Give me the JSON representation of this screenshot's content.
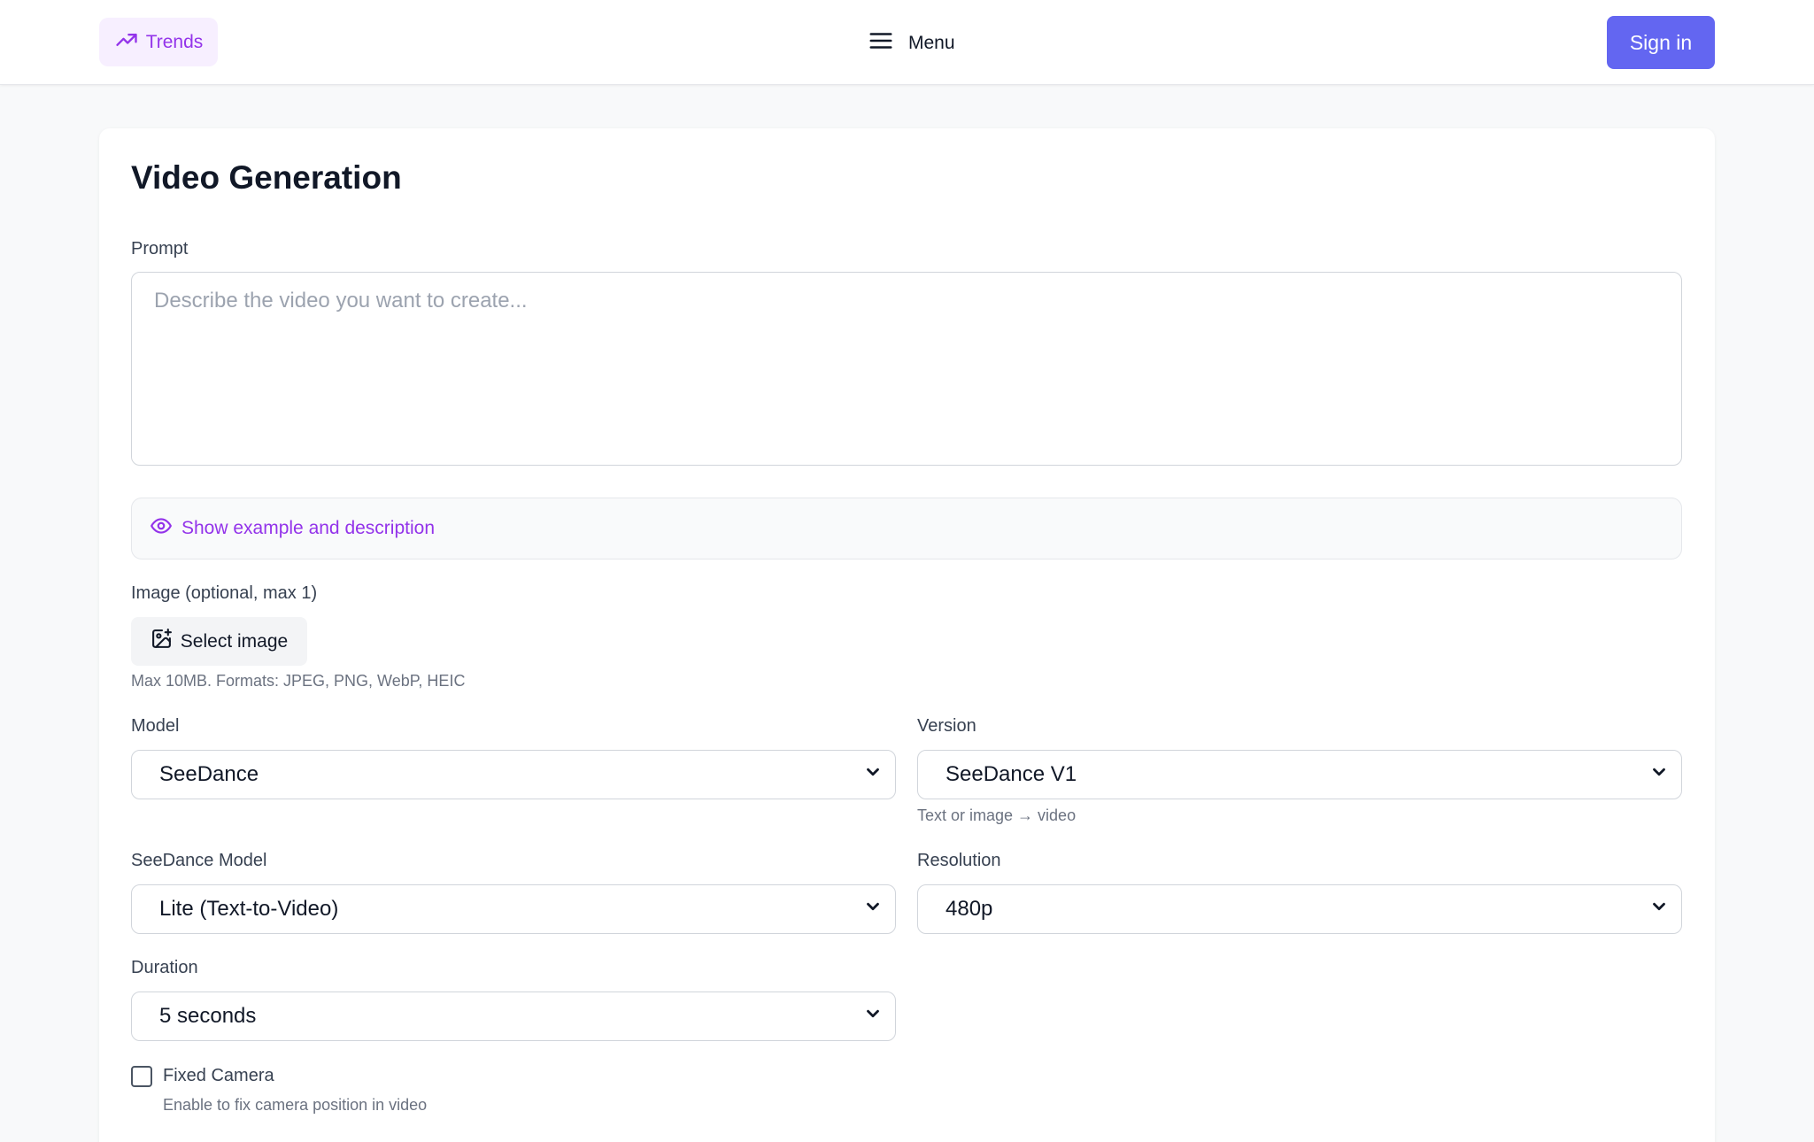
{
  "header": {
    "trends_label": "Trends",
    "menu_label": "Menu",
    "signin_label": "Sign in"
  },
  "main": {
    "title": "Video Generation",
    "prompt": {
      "label": "Prompt",
      "placeholder": "Describe the video you want to create...",
      "value": ""
    },
    "example_toggle": "Show example and description",
    "image": {
      "label": "Image (optional, max 1)",
      "button": "Select image",
      "hint": "Max 10MB. Formats: JPEG, PNG, WebP, HEIC"
    },
    "model": {
      "label": "Model",
      "value": "SeeDance"
    },
    "version": {
      "label": "Version",
      "value": "SeeDance V1",
      "hint": "Text or image → video"
    },
    "seedance_model": {
      "label": "SeeDance Model",
      "value": "Lite (Text-to-Video)"
    },
    "resolution": {
      "label": "Resolution",
      "value": "480p"
    },
    "duration": {
      "label": "Duration",
      "value": "5 seconds"
    },
    "fixed_camera": {
      "label": "Fixed Camera",
      "hint": "Enable to fix camera position in video",
      "checked": false
    }
  },
  "colors": {
    "accent": "#6366f1",
    "purple": "#9333ea",
    "background": "#f8f9fa"
  }
}
